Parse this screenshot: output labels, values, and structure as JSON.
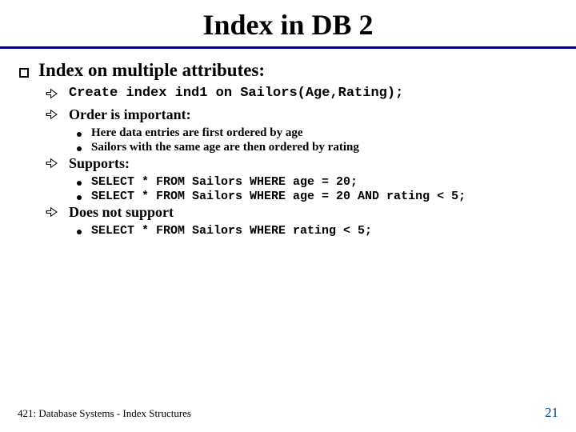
{
  "title": "Index in DB 2",
  "section1": {
    "heading": "Index on multiple attributes:",
    "create_stmt": "Create index ind1 on Sailors(Age,Rating);",
    "order_heading": "Order is important:",
    "order_points": [
      "Here data entries are first ordered by age",
      "Sailors with the same age are then ordered by rating"
    ],
    "supports_heading": "Supports:",
    "supports_points": [
      "SELECT * FROM Sailors WHERE age = 20;",
      "SELECT * FROM Sailors WHERE age = 20 AND rating < 5;"
    ],
    "not_support_heading": "Does not support",
    "not_support_points": [
      "SELECT * FROM Sailors WHERE rating < 5;"
    ]
  },
  "footer": {
    "left": "421: Database Systems - Index Structures",
    "page": "21"
  }
}
